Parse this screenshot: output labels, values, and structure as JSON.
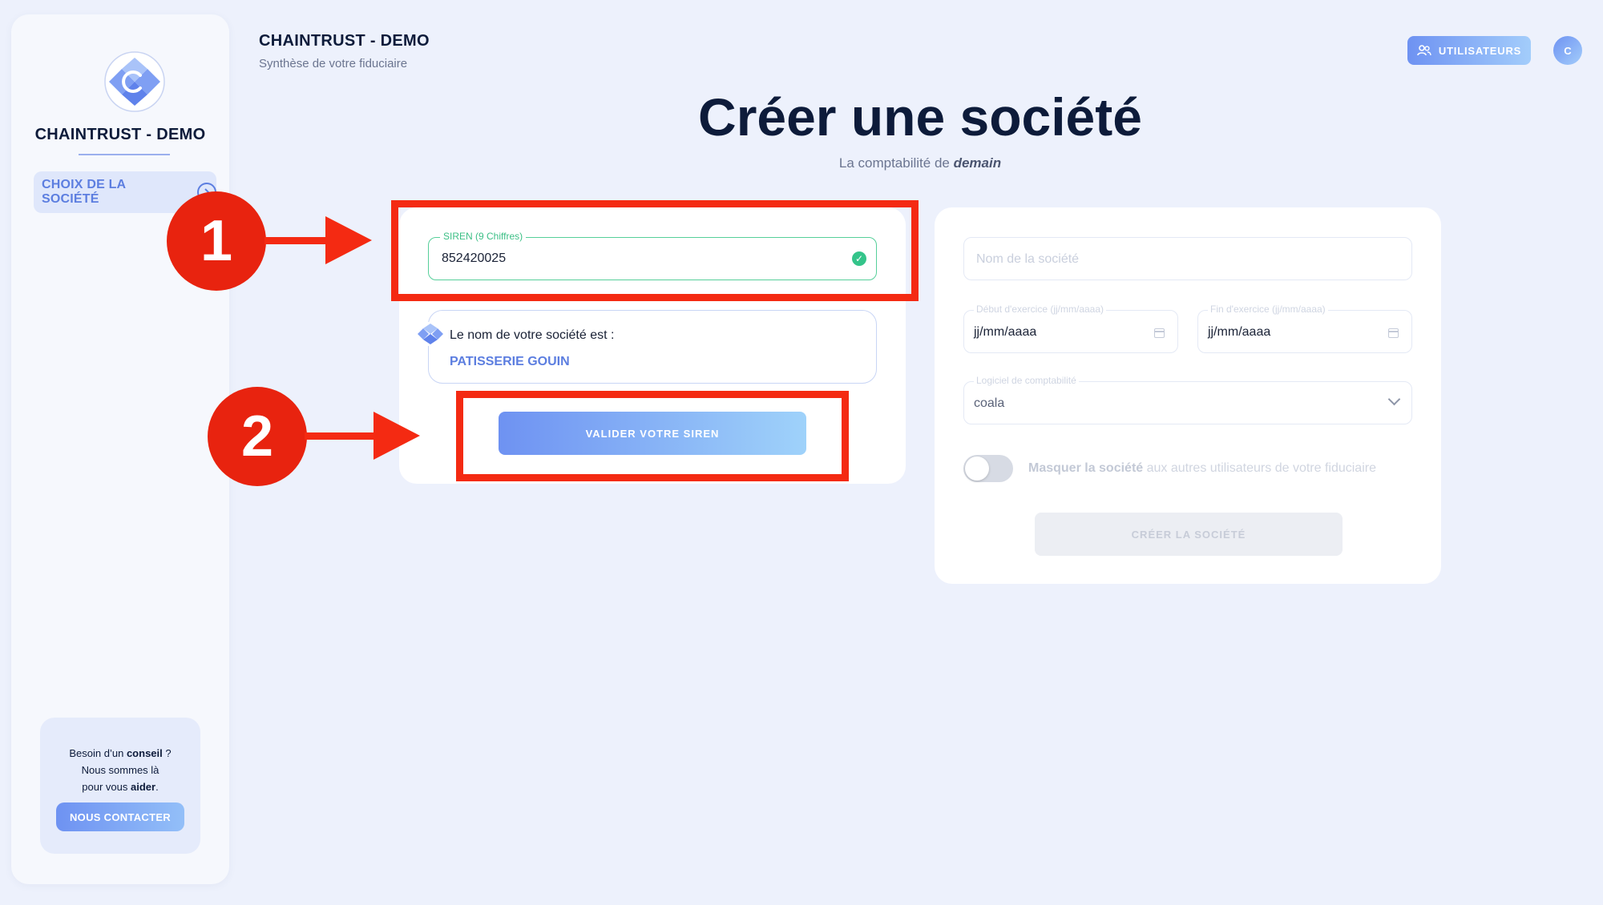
{
  "sidebar": {
    "brand": "CHAINTRUST - DEMO",
    "items": [
      {
        "label": "CHOIX DE LA SOCIÉTÉ"
      }
    ],
    "help": {
      "line1_prefix": "Besoin d’un ",
      "line1_bold": "conseil",
      "line1_suffix": " ?",
      "line2": "Nous sommes là",
      "line3_prefix": "pour vous ",
      "line3_bold": "aider",
      "line3_suffix": ".",
      "button": "NOUS CONTACTER"
    }
  },
  "header": {
    "title": "CHAINTRUST - DEMO",
    "subtitle": "Synthèse de votre fiduciaire",
    "users_button": "UTILISATEURS",
    "avatar_initial": "C"
  },
  "page": {
    "title": "Créer une société",
    "subtitle_prefix": "La comptabilité de ",
    "subtitle_emphasis": "demain"
  },
  "siren_form": {
    "field_label": "SIREN (9 Chiffres)",
    "field_value": "852420025",
    "result_label": "Le nom de votre société est :",
    "result_value": "PATISSERIE GOUIN",
    "validate_button": "VALIDER VOTRE SIREN"
  },
  "company_form": {
    "name_placeholder": "Nom de la société",
    "start_label": "Début d'exercice (jj/mm/aaaa)",
    "start_value": "jj/mm/aaaa",
    "end_label": "Fin d'exercice (jj/mm/aaaa)",
    "end_value": "jj/mm/aaaa",
    "software_label": "Logiciel de comptabilité",
    "software_value": "coala",
    "toggle_bold": "Masquer la société",
    "toggle_rest": " aux autres utilisateurs de votre fiduciaire",
    "create_button": "CRÉER LA SOCIÉTÉ"
  },
  "annotations": {
    "step1": "1",
    "step2": "2",
    "color": "#f42a12"
  },
  "colors": {
    "accent": "#6e92f2",
    "success": "#34c48a",
    "text_dark": "#0d1b3a",
    "background": "#edf1fc"
  }
}
